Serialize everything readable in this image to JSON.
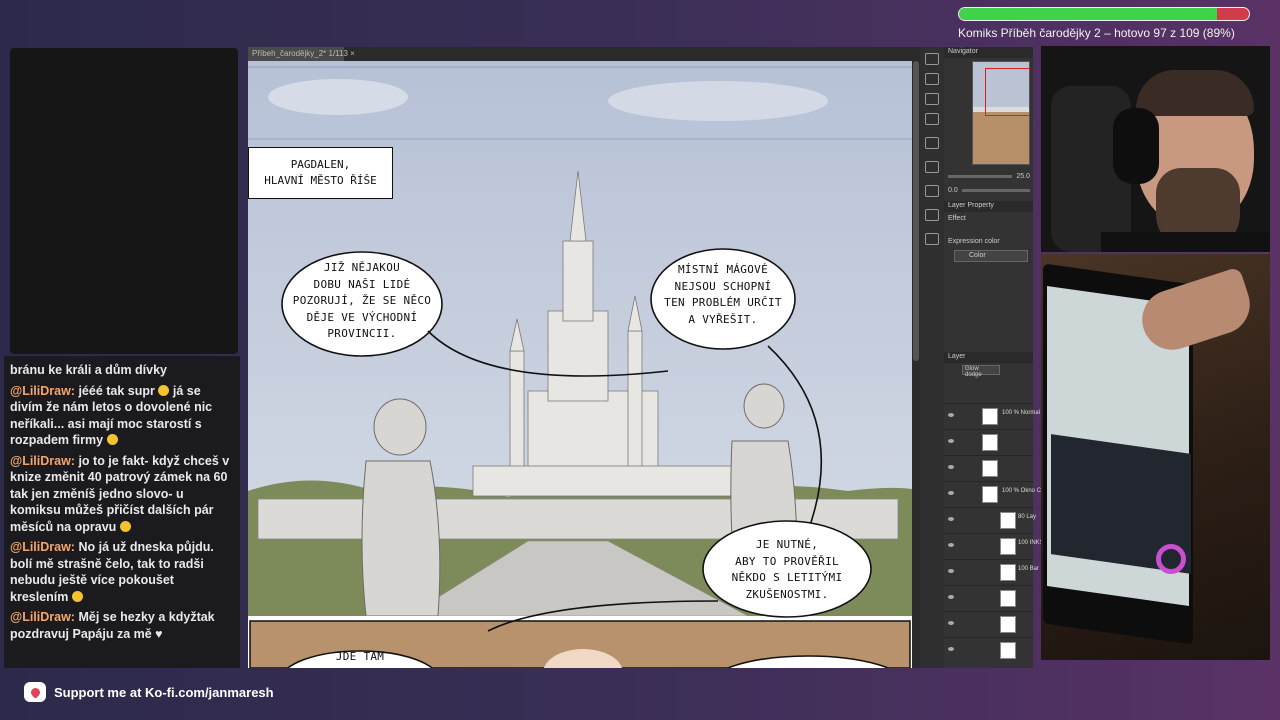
{
  "progress": {
    "fraction": 0.89,
    "label": "Komiks Příběh čarodějky 2 – hotovo 97 z 109 (89%)"
  },
  "chat": {
    "messages": [
      {
        "user": "",
        "text": "bránu ke králi a dům dívky"
      },
      {
        "user": "@LiliDraw:",
        "text": " jééé tak supr",
        "emoji1": true,
        "tail": " já se divím že nám letos o dovolené nic neříkali... asi mají moc starostí s rozpadem firmy ",
        "emoji2": true
      },
      {
        "user": "@LiliDraw:",
        "text": " jo to je fakt- když chceš v knize změnit 40 patrový zámek na 60 tak jen změníš jedno slovo- u komiksu můžeš přičíst dalších pár měsíců na opravu ",
        "emoji1": true
      },
      {
        "user": "@LiliDraw:",
        "text": " No já už dneska půjdu. bolí mě strašně čelo, tak to radši nebudu ještě více pokoušet kreslením ",
        "emoji1": true
      },
      {
        "user": "@LiliDraw:",
        "text": " Měj se hezky a kdyžtak pozdravuj Papáju za mě ♥"
      }
    ]
  },
  "footer": {
    "kofi_text": "Support me at Ko-fi.com/janmaresh",
    "icon": "ko-fi-cup-icon"
  },
  "app": {
    "tab_label": "Příbeh_čarodějky_2* 1/113",
    "navigator_label": "Navigator",
    "zoom_value": "25.0",
    "rotate_value": "0.0",
    "layer_property_label": "Layer Property",
    "effect_label": "Effect",
    "expression_color_label": "Expression color",
    "color_mode": "Color",
    "layer_panel_label": "Layer",
    "blend_mode": "Glow dodge",
    "layers": [
      {
        "name": "100 % Normal text"
      },
      {
        "name": ""
      },
      {
        "name": ""
      },
      {
        "name": "100 % Okno C"
      },
      {
        "name": "80 Lay"
      },
      {
        "name": "100 INKS"
      },
      {
        "name": "100 Bar"
      },
      {
        "name": ""
      },
      {
        "name": ""
      },
      {
        "name": ""
      }
    ]
  },
  "comic": {
    "caption_line1": "PAGDALEN,",
    "caption_line2": "HLAVNÍ MĚSTO ŘÍŠE",
    "bubble1": [
      "JIŽ NĚJAKOU",
      "DOBU NAŠI LIDÉ",
      "POZORUJÍ, ŽE SE NĚCO",
      "DĚJE VE VÝCHODNÍ",
      "PROVINCII."
    ],
    "bubble2": [
      "MÍSTNÍ MÁGOVÉ",
      "NEJSOU SCHOPNÍ",
      "TEN PROBLÉM URČIT",
      "A VYŘEŠIT."
    ],
    "bubble3": [
      "JE NUTNÉ,",
      "ABY TO PROVĚŘIL",
      "NĚKDO S LETITÝMI",
      "ZKUŠENOSTMI."
    ],
    "bubble4": "JDE TAM"
  },
  "colors": {
    "progress_done": "#3fd24a",
    "progress_remaining": "#d23c4a",
    "chat_username": "#f3a66a",
    "sky": "#c3cbdc"
  }
}
